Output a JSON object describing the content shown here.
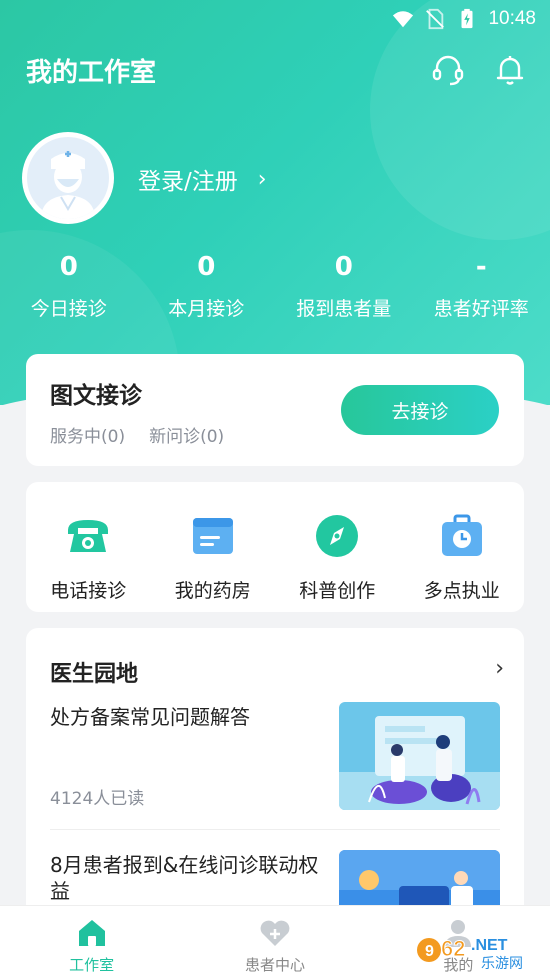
{
  "status_bar": {
    "time": "10:48",
    "icons": [
      "wifi-icon",
      "no-sim-icon",
      "battery-icon"
    ]
  },
  "header": {
    "title": "我的工作室",
    "icons": [
      "headset-icon",
      "bell-icon"
    ]
  },
  "profile": {
    "login_label": "登录/注册",
    "avatar_icon": "doctor-avatar-icon"
  },
  "stats": [
    {
      "value": "0",
      "label": "今日接诊"
    },
    {
      "value": "0",
      "label": "本月接诊"
    },
    {
      "value": "0",
      "label": "报到患者量"
    },
    {
      "value": "-",
      "label": "患者好评率"
    }
  ],
  "consult": {
    "title": "图文接诊",
    "in_service": "服务中(0)",
    "new_consult": "新问诊(0)",
    "button": "去接诊"
  },
  "tools": [
    {
      "label": "电话接诊",
      "icon": "phone-icon"
    },
    {
      "label": "我的药房",
      "icon": "pharmacy-card-icon"
    },
    {
      "label": "科普创作",
      "icon": "compass-icon"
    },
    {
      "label": "多点执业",
      "icon": "briefcase-clock-icon"
    }
  ],
  "garden": {
    "title": "医生园地",
    "articles": [
      {
        "title": "处方备案常见问题解答",
        "meta": "4124人已读"
      },
      {
        "title": "8月患者报到&在线问诊联动权益",
        "meta": ""
      }
    ]
  },
  "tabbar": {
    "tabs": [
      {
        "label": "工作室",
        "icon": "home-icon",
        "active": true
      },
      {
        "label": "患者中心",
        "icon": "heart-plus-icon",
        "active": false
      },
      {
        "label": "我的",
        "icon": "user-icon",
        "active": false
      }
    ]
  },
  "colors": {
    "primary": "#2cc7a4",
    "accent_text": "#20c19e",
    "background": "#f2f3f5"
  },
  "watermark": {
    "brand": "962.NET",
    "subtitle": "乐游网"
  }
}
